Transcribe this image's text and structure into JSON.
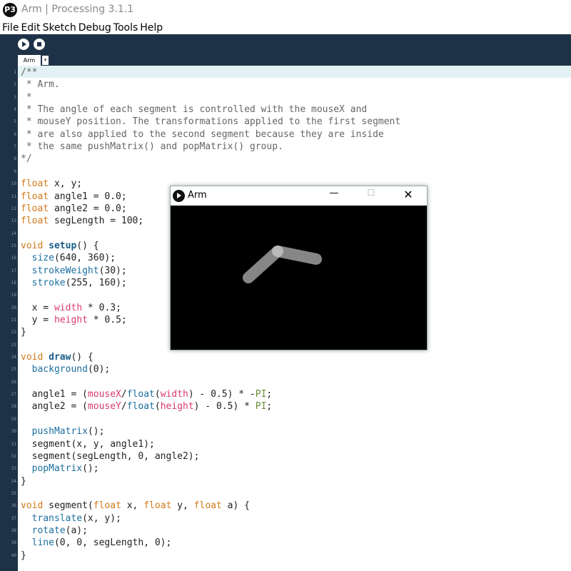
{
  "window": {
    "title": "Arm | Processing 3.1.1",
    "logo_text": "P3"
  },
  "menu": [
    "File",
    "Edit",
    "Sketch",
    "Debug",
    "Tools",
    "Help"
  ],
  "toolbar": {
    "run": "run-icon",
    "stop": "stop-icon"
  },
  "tabs": [
    {
      "label": "Arm",
      "menu_glyph": "▾"
    }
  ],
  "sketch_window": {
    "title": "Arm",
    "min_glyph": "—",
    "max_glyph": "☐",
    "close_glyph": "✕",
    "arm_color": "#d9d9d9",
    "background": "#000000"
  },
  "code_lines": [
    [
      [
        "cm",
        "/**"
      ]
    ],
    [
      [
        "cm",
        " * Arm."
      ]
    ],
    [
      [
        "cm",
        " *"
      ]
    ],
    [
      [
        "cm",
        " * The angle of each segment is controlled with the mouseX and"
      ]
    ],
    [
      [
        "cm",
        " * mouseY position. The transformations applied to the first segment"
      ]
    ],
    [
      [
        "cm",
        " * are also applied to the second segment because they are inside"
      ]
    ],
    [
      [
        "cm",
        " * the same pushMatrix() and popMatrix() group."
      ]
    ],
    [
      [
        "cm",
        "*/"
      ]
    ],
    [],
    [
      [
        "kw",
        "float"
      ],
      [
        "t",
        " x, y;"
      ]
    ],
    [
      [
        "kw",
        "float"
      ],
      [
        "t",
        " angle1 = 0.0;"
      ]
    ],
    [
      [
        "kw",
        "float"
      ],
      [
        "t",
        " angle2 = 0.0;"
      ]
    ],
    [
      [
        "kw",
        "float"
      ],
      [
        "t",
        " segLength = 100;"
      ]
    ],
    [],
    [
      [
        "kw",
        "void"
      ],
      [
        "t",
        " "
      ],
      [
        "fnb",
        "setup"
      ],
      [
        "t",
        "() {"
      ]
    ],
    [
      [
        "t",
        "  "
      ],
      [
        "fn",
        "size"
      ],
      [
        "t",
        "(640, 360);"
      ]
    ],
    [
      [
        "t",
        "  "
      ],
      [
        "fn",
        "strokeWeight"
      ],
      [
        "t",
        "(30);"
      ]
    ],
    [
      [
        "t",
        "  "
      ],
      [
        "fn",
        "stroke"
      ],
      [
        "t",
        "(255, 160);"
      ]
    ],
    [],
    [
      [
        "t",
        "  x = "
      ],
      [
        "pk",
        "width"
      ],
      [
        "t",
        " * 0.3;"
      ]
    ],
    [
      [
        "t",
        "  y = "
      ],
      [
        "pk",
        "height"
      ],
      [
        "t",
        " * 0.5;"
      ]
    ],
    [
      [
        "t",
        "}"
      ]
    ],
    [],
    [
      [
        "kw",
        "void"
      ],
      [
        "t",
        " "
      ],
      [
        "fnb",
        "draw"
      ],
      [
        "t",
        "() {"
      ]
    ],
    [
      [
        "t",
        "  "
      ],
      [
        "fn",
        "background"
      ],
      [
        "t",
        "(0);"
      ]
    ],
    [],
    [
      [
        "t",
        "  angle1 = ("
      ],
      [
        "pk",
        "mouseX"
      ],
      [
        "t",
        "/"
      ],
      [
        "fn",
        "float"
      ],
      [
        "t",
        "("
      ],
      [
        "pk",
        "width"
      ],
      [
        "t",
        ") - 0.5) * -"
      ],
      [
        "pi",
        "PI"
      ],
      [
        "t",
        ";"
      ]
    ],
    [
      [
        "t",
        "  angle2 = ("
      ],
      [
        "pk",
        "mouseY"
      ],
      [
        "t",
        "/"
      ],
      [
        "fn",
        "float"
      ],
      [
        "t",
        "("
      ],
      [
        "pk",
        "height"
      ],
      [
        "t",
        ") - 0.5) * "
      ],
      [
        "pi",
        "PI"
      ],
      [
        "t",
        ";"
      ]
    ],
    [],
    [
      [
        "t",
        "  "
      ],
      [
        "fn",
        "pushMatrix"
      ],
      [
        "t",
        "();"
      ]
    ],
    [
      [
        "t",
        "  segment(x, y, angle1);"
      ]
    ],
    [
      [
        "t",
        "  segment(segLength, 0, angle2);"
      ]
    ],
    [
      [
        "t",
        "  "
      ],
      [
        "fn",
        "popMatrix"
      ],
      [
        "t",
        "();"
      ]
    ],
    [
      [
        "t",
        "}"
      ]
    ],
    [],
    [
      [
        "kw",
        "void"
      ],
      [
        "t",
        " segment("
      ],
      [
        "kw",
        "float"
      ],
      [
        "t",
        " x, "
      ],
      [
        "kw",
        "float"
      ],
      [
        "t",
        " y, "
      ],
      [
        "kw",
        "float"
      ],
      [
        "t",
        " a) {"
      ]
    ],
    [
      [
        "t",
        "  "
      ],
      [
        "fn",
        "translate"
      ],
      [
        "t",
        "(x, y);"
      ]
    ],
    [
      [
        "t",
        "  "
      ],
      [
        "fn",
        "rotate"
      ],
      [
        "t",
        "(a);"
      ]
    ],
    [
      [
        "t",
        "  "
      ],
      [
        "fn",
        "line"
      ],
      [
        "t",
        "(0, 0, segLength, 0);"
      ]
    ],
    [
      [
        "t",
        "}"
      ]
    ]
  ]
}
